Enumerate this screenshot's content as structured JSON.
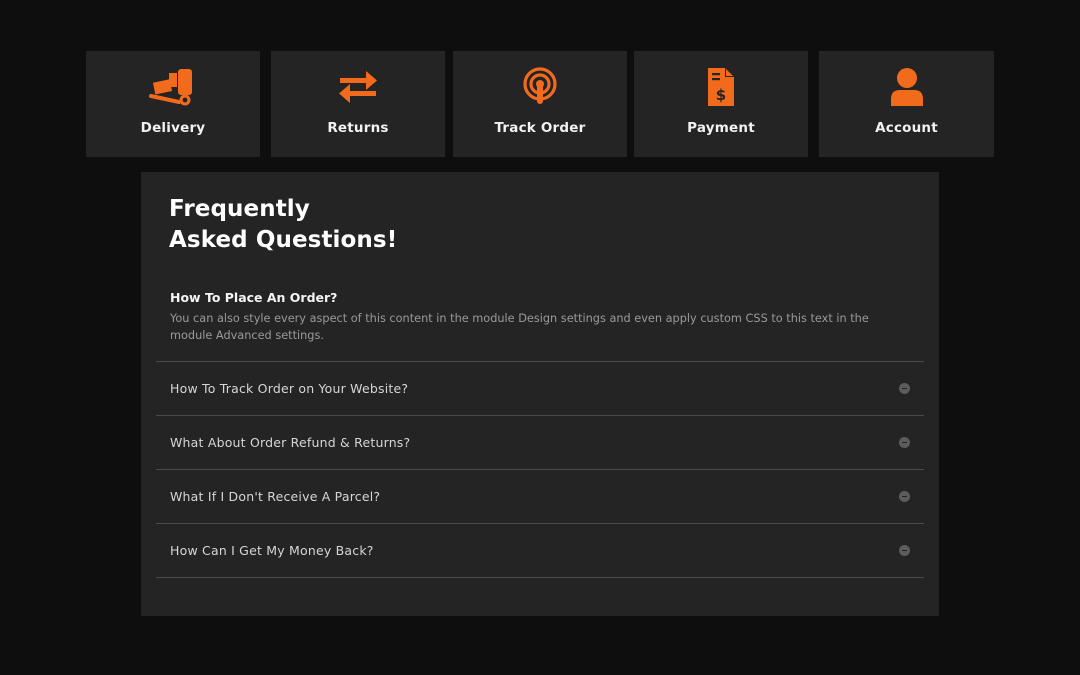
{
  "colors": {
    "accent": "#f26b1d",
    "background": "#0e0e0f",
    "card": "#242425"
  },
  "tiles": [
    {
      "label": "Delivery",
      "icon": "delivery-truck-icon"
    },
    {
      "label": "Returns",
      "icon": "swap-arrows-icon"
    },
    {
      "label": "Track Order",
      "icon": "location-signal-icon"
    },
    {
      "label": "Payment",
      "icon": "invoice-dollar-icon"
    },
    {
      "label": "Account",
      "icon": "user-icon"
    }
  ],
  "faq": {
    "title_line1": "Frequently",
    "title_line2": "Asked Questions!",
    "open_item": {
      "question": "How To Place An Order?",
      "answer": "You can also style every aspect of this content in the module Design settings and even apply custom CSS to this text in the module Advanced settings."
    },
    "items": [
      {
        "question": "How To Track Order on Your Website?"
      },
      {
        "question": "What About Order Refund & Returns?"
      },
      {
        "question": "What If I Don't Receive A Parcel?"
      },
      {
        "question": "How Can I Get My Money Back?"
      }
    ]
  }
}
